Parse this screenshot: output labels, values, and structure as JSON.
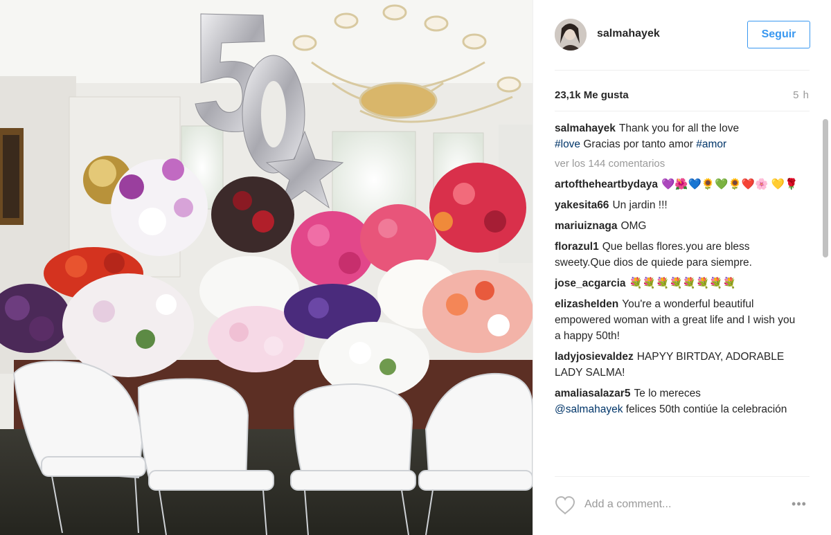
{
  "header": {
    "username": "salmahayek",
    "follow_label": "Seguir"
  },
  "stats": {
    "likes": "23,1k Me gusta",
    "time_ago": "5 h"
  },
  "caption": {
    "user": "salmahayek",
    "text1": "Thank you for all the love",
    "tag1": "#love",
    "text2": "Gracias por tanto amor",
    "tag2": "#amor"
  },
  "view_all": "ver los 144 comentarios",
  "comments": [
    {
      "user": "artoftheheartbydaya",
      "text": "💜🌺💙🌻💚🌻❤️🌸 💛🌹"
    },
    {
      "user": "yakesita66",
      "text": "Un jardin !!!"
    },
    {
      "user": "mariuiznaga",
      "text": "OMG"
    },
    {
      "user": "florazul1",
      "text": "Que bellas flores.you are bless sweety.Que dios de quiede para siempre."
    },
    {
      "user": "jose_acgarcia",
      "text": "💐💐💐💐💐💐💐💐"
    },
    {
      "user": "elizasheIden",
      "text": "You're a wonderful beautiful empowered woman with a great life and I wish you a happy 50th!"
    },
    {
      "user": "ladyjosievaldez",
      "text": "HAPYY BIRTDAY, ADORABLE LADY SALMA!"
    }
  ],
  "last_comment": {
    "user": "amaliasalazar5",
    "text1": "Te lo mereces",
    "mention": "@salmahayek",
    "text2": "felices 50th contiúe la celebración"
  },
  "footer": {
    "placeholder": "Add a comment...",
    "more_label": "•••"
  },
  "colors": {
    "accent": "#3897f0",
    "hashtag": "#003569",
    "muted": "#999999"
  },
  "icons": {
    "like": "heart-outline-icon",
    "options": "more-options-icon"
  }
}
